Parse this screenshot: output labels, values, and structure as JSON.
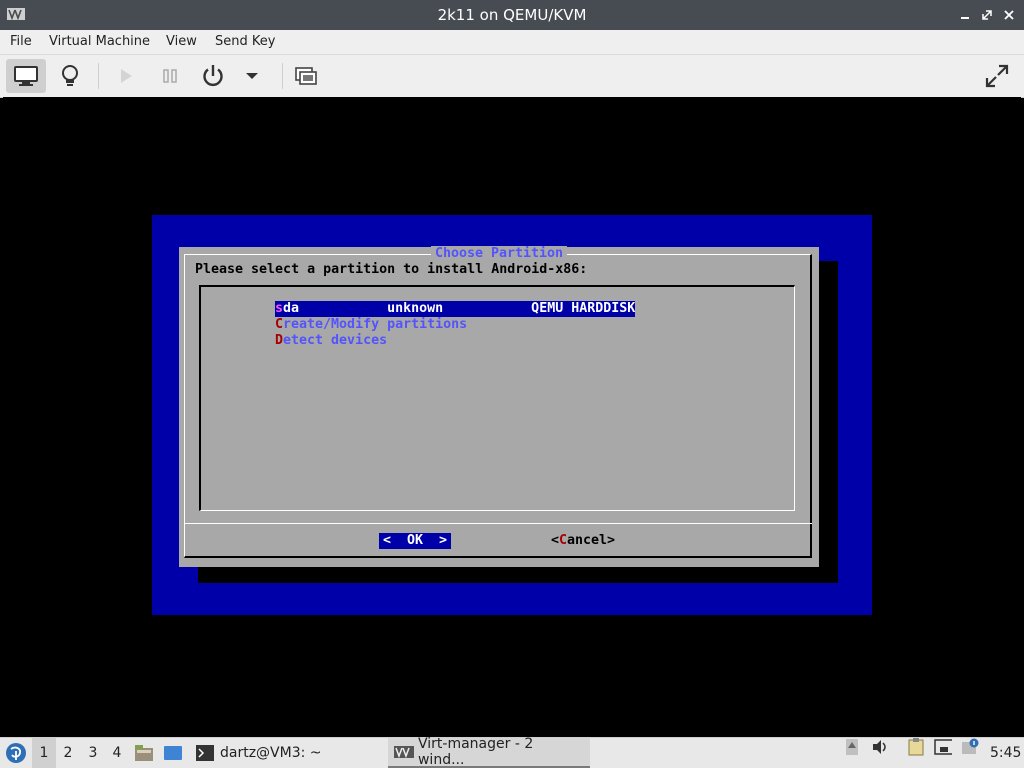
{
  "window": {
    "title": "2k11 on QEMU/KVM",
    "buttons": [
      "minimize",
      "restore",
      "close"
    ]
  },
  "menubar": {
    "items": [
      "File",
      "Virtual Machine",
      "View",
      "Send Key"
    ]
  },
  "toolbar": {
    "buttons": [
      "console-icon",
      "details-bulb-icon",
      "run-icon",
      "pause-icon",
      "power-icon",
      "power-dropdown-icon",
      "snapshots-icon",
      "fullscreen-icon"
    ]
  },
  "console": {
    "dialog_title": "Choose Partition",
    "prompt": "Please select a partition to install Android-x86:",
    "items": [
      {
        "hotkey": "s",
        "rest": "da           unknown           QEMU HARDDISK",
        "selected": true
      },
      {
        "hotkey": "C",
        "rest": "reate/Modify partitions",
        "selected": false
      },
      {
        "hotkey": "D",
        "rest": "etect devices",
        "selected": false
      }
    ],
    "ok_label": "<  OK  >",
    "cancel_prefix": "<",
    "cancel_hotkey": "C",
    "cancel_rest": "ancel>",
    "colors": {
      "background": "#0000a8",
      "dialog": "#a8a8a8",
      "title": "#5454fc",
      "hotkey": "#a80000"
    }
  },
  "taskbar": {
    "workspaces": [
      "1",
      "2",
      "3",
      "4"
    ],
    "active_workspace": "1",
    "tasks": [
      {
        "label": "dartz@VM3: ~",
        "icon": "terminal-icon"
      },
      {
        "label": "Virt-manager - 2 wind...",
        "icon": "virt-manager-icon"
      }
    ],
    "clock": "5:45"
  }
}
